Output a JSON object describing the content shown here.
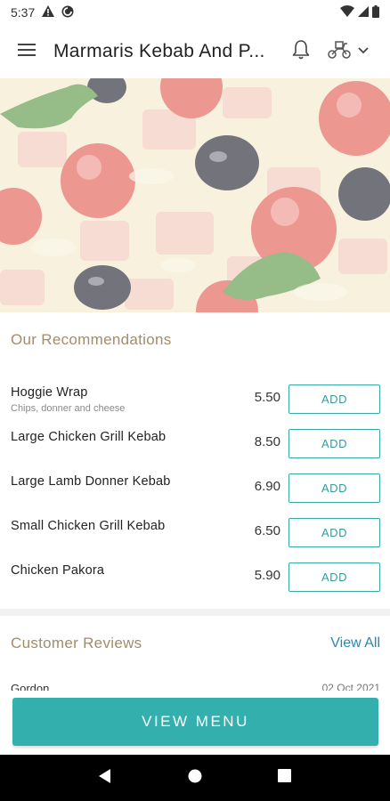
{
  "status_bar": {
    "time": "5:37",
    "icons": [
      "alert-icon",
      "data-saver-icon",
      "wifi-icon",
      "signal-icon",
      "battery-icon"
    ]
  },
  "app_bar": {
    "title": "Marmaris Kebab And P...",
    "icons": [
      "menu-icon",
      "bell-icon",
      "delivery-scooter-icon",
      "chevron-down-icon"
    ]
  },
  "recommendations": {
    "title": "Our Recommendations",
    "add_label": "ADD",
    "items": [
      {
        "name": "Hoggie Wrap",
        "desc": "Chips, donner and cheese",
        "price": "5.50"
      },
      {
        "name": "Large Chicken Grill Kebab",
        "desc": "",
        "price": "8.50"
      },
      {
        "name": "Large Lamb Donner Kebab",
        "desc": "",
        "price": "6.90"
      },
      {
        "name": "Small Chicken Grill Kebab",
        "desc": "",
        "price": "6.50"
      },
      {
        "name": "Chicken Pakora",
        "desc": "",
        "price": "5.90"
      }
    ]
  },
  "reviews": {
    "title": "Customer Reviews",
    "view_all": "View All",
    "first": {
      "name": "Gordon",
      "date": "02 Oct 2021"
    }
  },
  "cta": {
    "label": "VIEW MENU"
  },
  "colors": {
    "accent": "#33b0ae",
    "section_title": "#a38c6a",
    "link": "#2b87b0"
  }
}
